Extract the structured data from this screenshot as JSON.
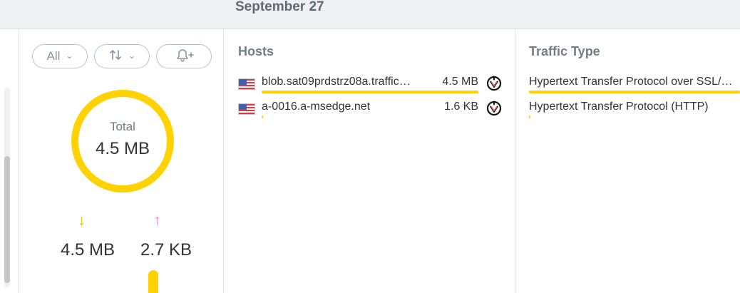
{
  "header": {
    "date": "September 27"
  },
  "filters": {
    "all_label": "All",
    "chevron": "chevron-down-icon",
    "sort_icon": "sort-icon",
    "bell_icon": "bell-plus-icon"
  },
  "summary": {
    "total_label": "Total",
    "total_value": "4.5 MB",
    "download_value": "4.5 MB",
    "upload_value": "2.7 KB",
    "download_color": "#f2c300",
    "upload_color": "#ef8fd0",
    "donut_color": "#ffd200"
  },
  "hosts": {
    "title": "Hosts",
    "rows": [
      {
        "name": "blob.sat09prdstrz08a.traffic…",
        "size": "4.5 MB",
        "flag": "us-flag-icon",
        "icon": "process-icon",
        "share": 1.0
      },
      {
        "name": "a-0016.a-msedge.net",
        "size": "1.6 KB",
        "flag": "us-flag-icon",
        "icon": "process-icon",
        "share": 0.0004
      }
    ]
  },
  "traffic": {
    "title": "Traffic Type",
    "rows": [
      {
        "name": "Hypertext Transfer Protocol over SSL/…",
        "share": 1.0
      },
      {
        "name": "Hypertext Transfer Protocol (HTTP)",
        "share": 0.0004
      }
    ]
  }
}
